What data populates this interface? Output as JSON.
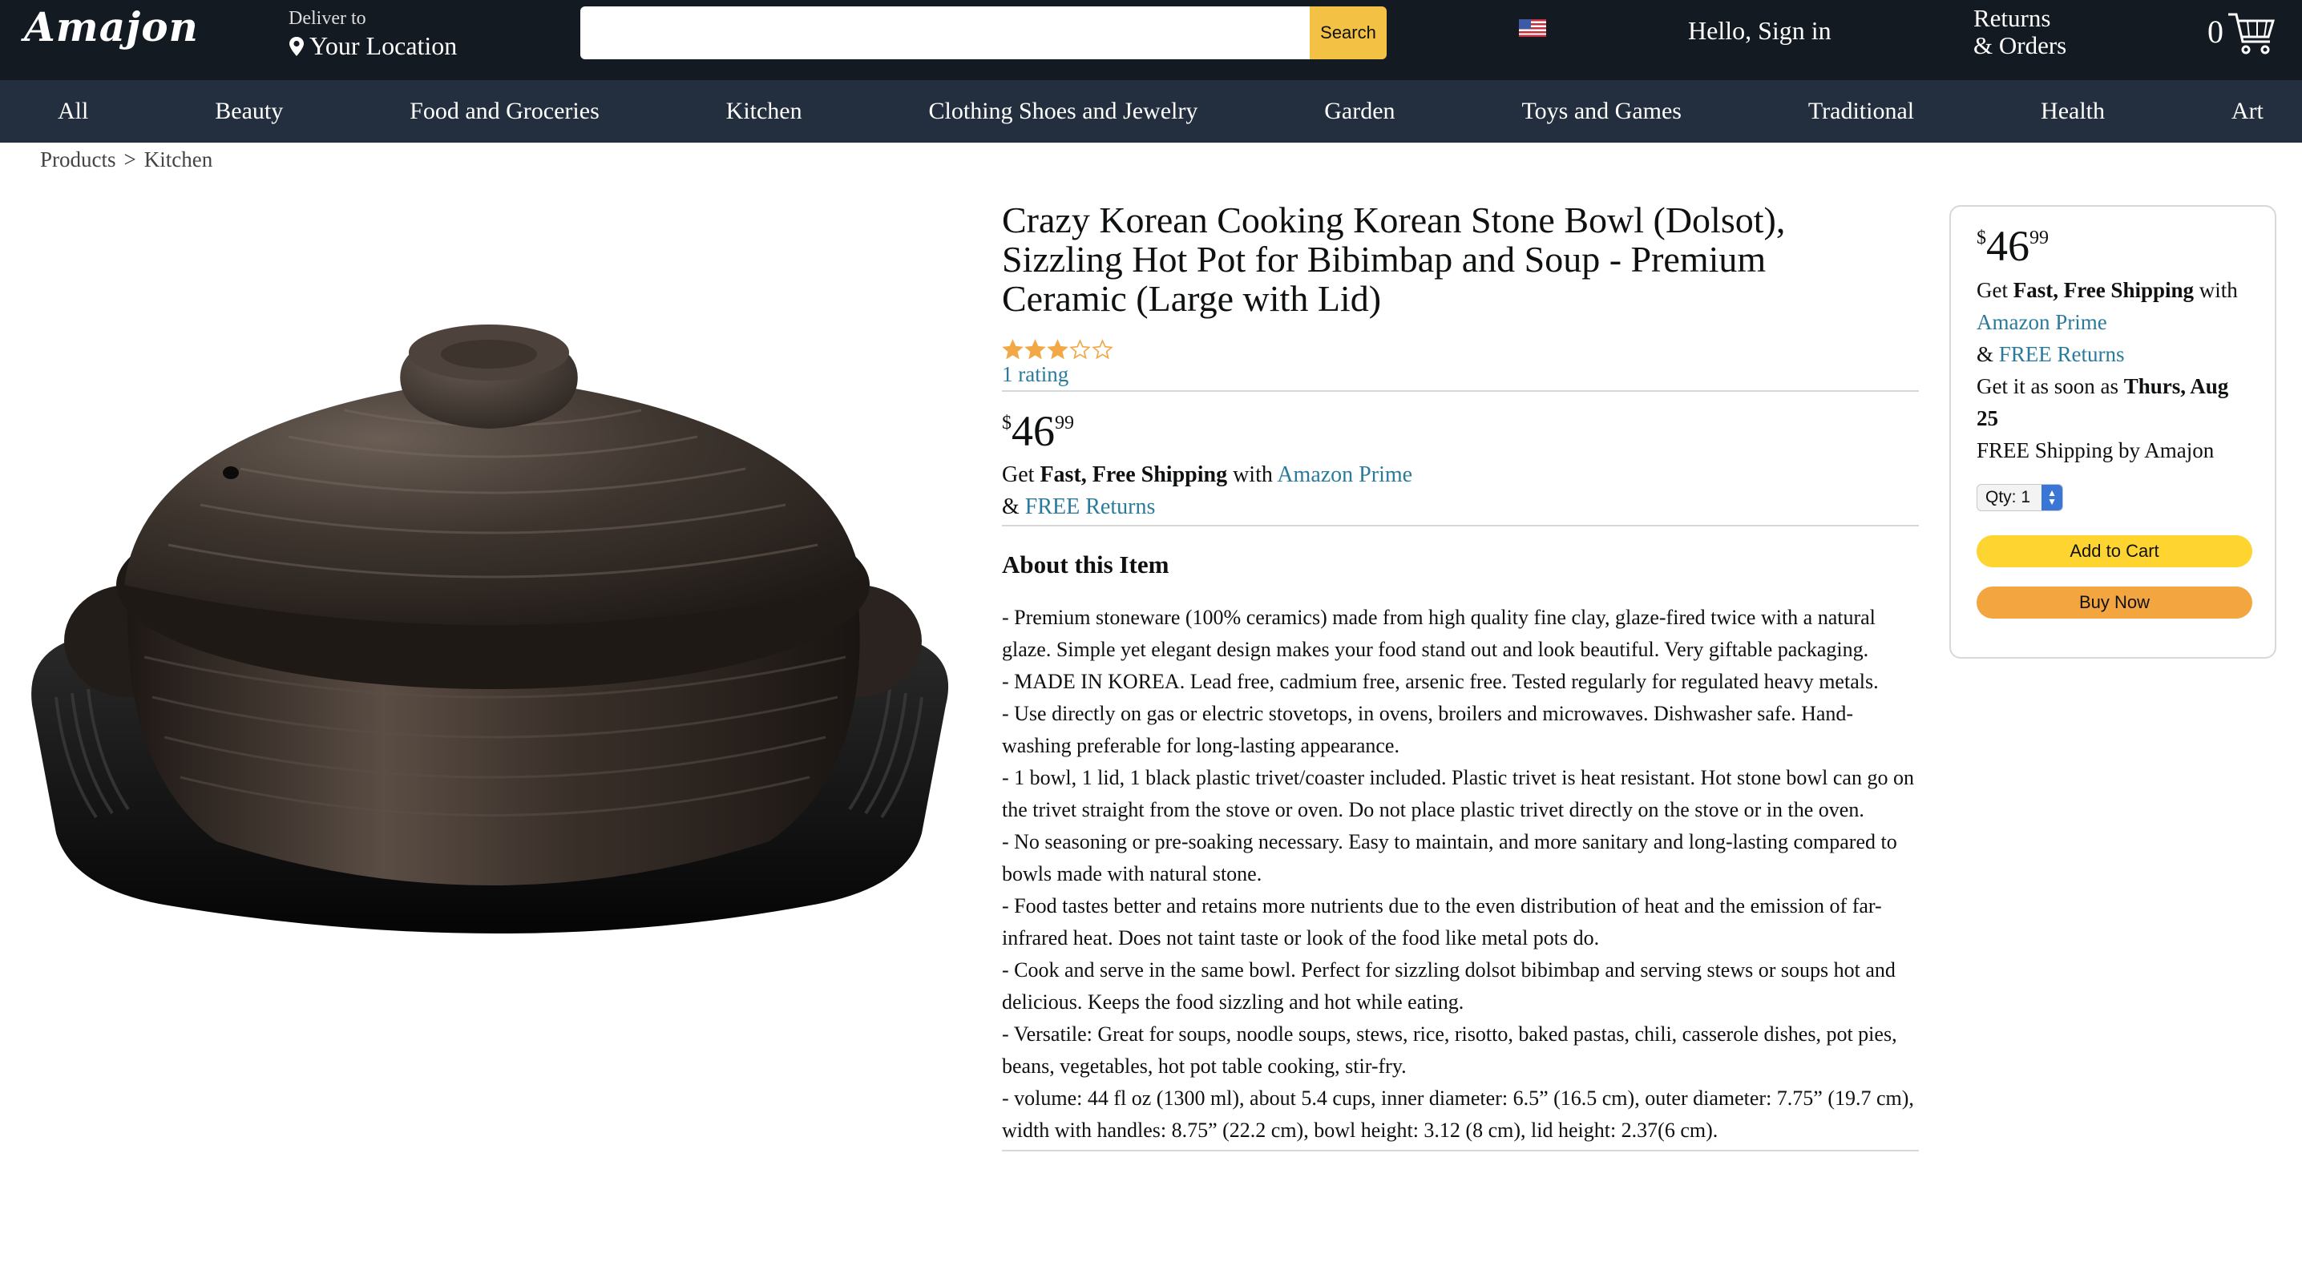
{
  "header": {
    "logo": "Amajon",
    "deliver_label": "Deliver to",
    "deliver_location": "Your Location",
    "search_placeholder": "",
    "search_button": "Search",
    "flag_icon": "us-flag-icon",
    "signin": "Hello, Sign in",
    "returns_line1": "Returns",
    "returns_line2": "& Orders",
    "cart_count": "0",
    "cart_icon": "cart-icon"
  },
  "nav": {
    "items": [
      "All",
      "Beauty",
      "Food and Groceries",
      "Kitchen",
      "Clothing Shoes and Jewelry",
      "Garden",
      "Toys and Games",
      "Traditional",
      "Health",
      "Art"
    ]
  },
  "breadcrumb": {
    "root": "Products",
    "separator": ">",
    "current": "Kitchen"
  },
  "product": {
    "title": "Crazy Korean Cooking Korean Stone Bowl (Dolsot), Sizzling Hot Pot for Bibimbap and Soup - Premium Ceramic (Large with Lid)",
    "rating_stars": 3,
    "rating_max": 5,
    "rating_text": "1 rating",
    "price_symbol": "$",
    "price_whole": "46",
    "price_fraction": "99",
    "ship_get": "Get",
    "ship_bold": "Fast, Free Shipping",
    "ship_with": "with",
    "prime_link": "Amazon Prime",
    "returns_amp": "&",
    "returns_link": "FREE Returns",
    "about_title": "About this Item",
    "bullets": [
      "- Premium stoneware (100% ceramics) made from high quality fine clay, glaze-fired twice with a natural glaze. Simple yet elegant design makes your food stand out and look beautiful. Very giftable packaging.",
      "- MADE IN KOREA. Lead free, cadmium free, arsenic free. Tested regularly for regulated heavy metals.",
      "- Use directly on gas or electric stovetops, in ovens, broilers and microwaves. Dishwasher safe. Hand-washing preferable for long-lasting appearance.",
      "- 1 bowl, 1 lid, 1 black plastic trivet/coaster included. Plastic trivet is heat resistant. Hot stone bowl can go on the trivet straight from the stove or oven. Do not place plastic trivet directly on the stove or in the oven.",
      "- No seasoning or pre-soaking necessary. Easy to maintain, and more sanitary and long-lasting compared to bowls made with natural stone.",
      "- Food tastes better and retains more nutrients due to the even distribution of heat and the emission of far-infrared heat. Does not taint taste or look of the food like metal pots do.",
      "- Cook and serve in the same bowl. Perfect for sizzling dolsot bibimbap and serving stews or soups hot and delicious. Keeps the food sizzling and hot while eating.",
      "- Versatile: Great for soups, noodle soups, stews, rice, risotto, baked pastas, chili, casserole dishes, pot pies, beans, vegetables, hot pot table cooking, stir-fry.",
      "- volume: 44 fl oz (1300 ml), about 5.4 cups, inner diameter: 6.5” (16.5 cm), outer diameter: 7.75” (19.7 cm), width with handles: 8.75” (22.2 cm), bowl height: 3.12 (8 cm), lid height: 2.37(6 cm)."
    ]
  },
  "buybox": {
    "price_symbol": "$",
    "price_whole": "46",
    "price_fraction": "99",
    "ship_get": "Get",
    "ship_bold": "Fast, Free Shipping",
    "ship_with": "with",
    "prime_link": "Amazon Prime",
    "returns_amp": "&",
    "returns_link": "FREE Returns",
    "delivery_prefix": "Get it as soon as",
    "delivery_date": "Thurs, Aug 25",
    "free_shipping_by": "FREE Shipping by Amajon",
    "qty_label": "Qty: 1",
    "add_to_cart": "Add to Cart",
    "buy_now": "Buy Now"
  },
  "colors": {
    "header_bg": "#131a22",
    "nav_bg": "#232f3e",
    "search_button": "#f3c245",
    "link": "#2a7b9b",
    "star": "#f3a847",
    "add_to_cart": "#fed530",
    "buy_now": "#f3a540"
  }
}
